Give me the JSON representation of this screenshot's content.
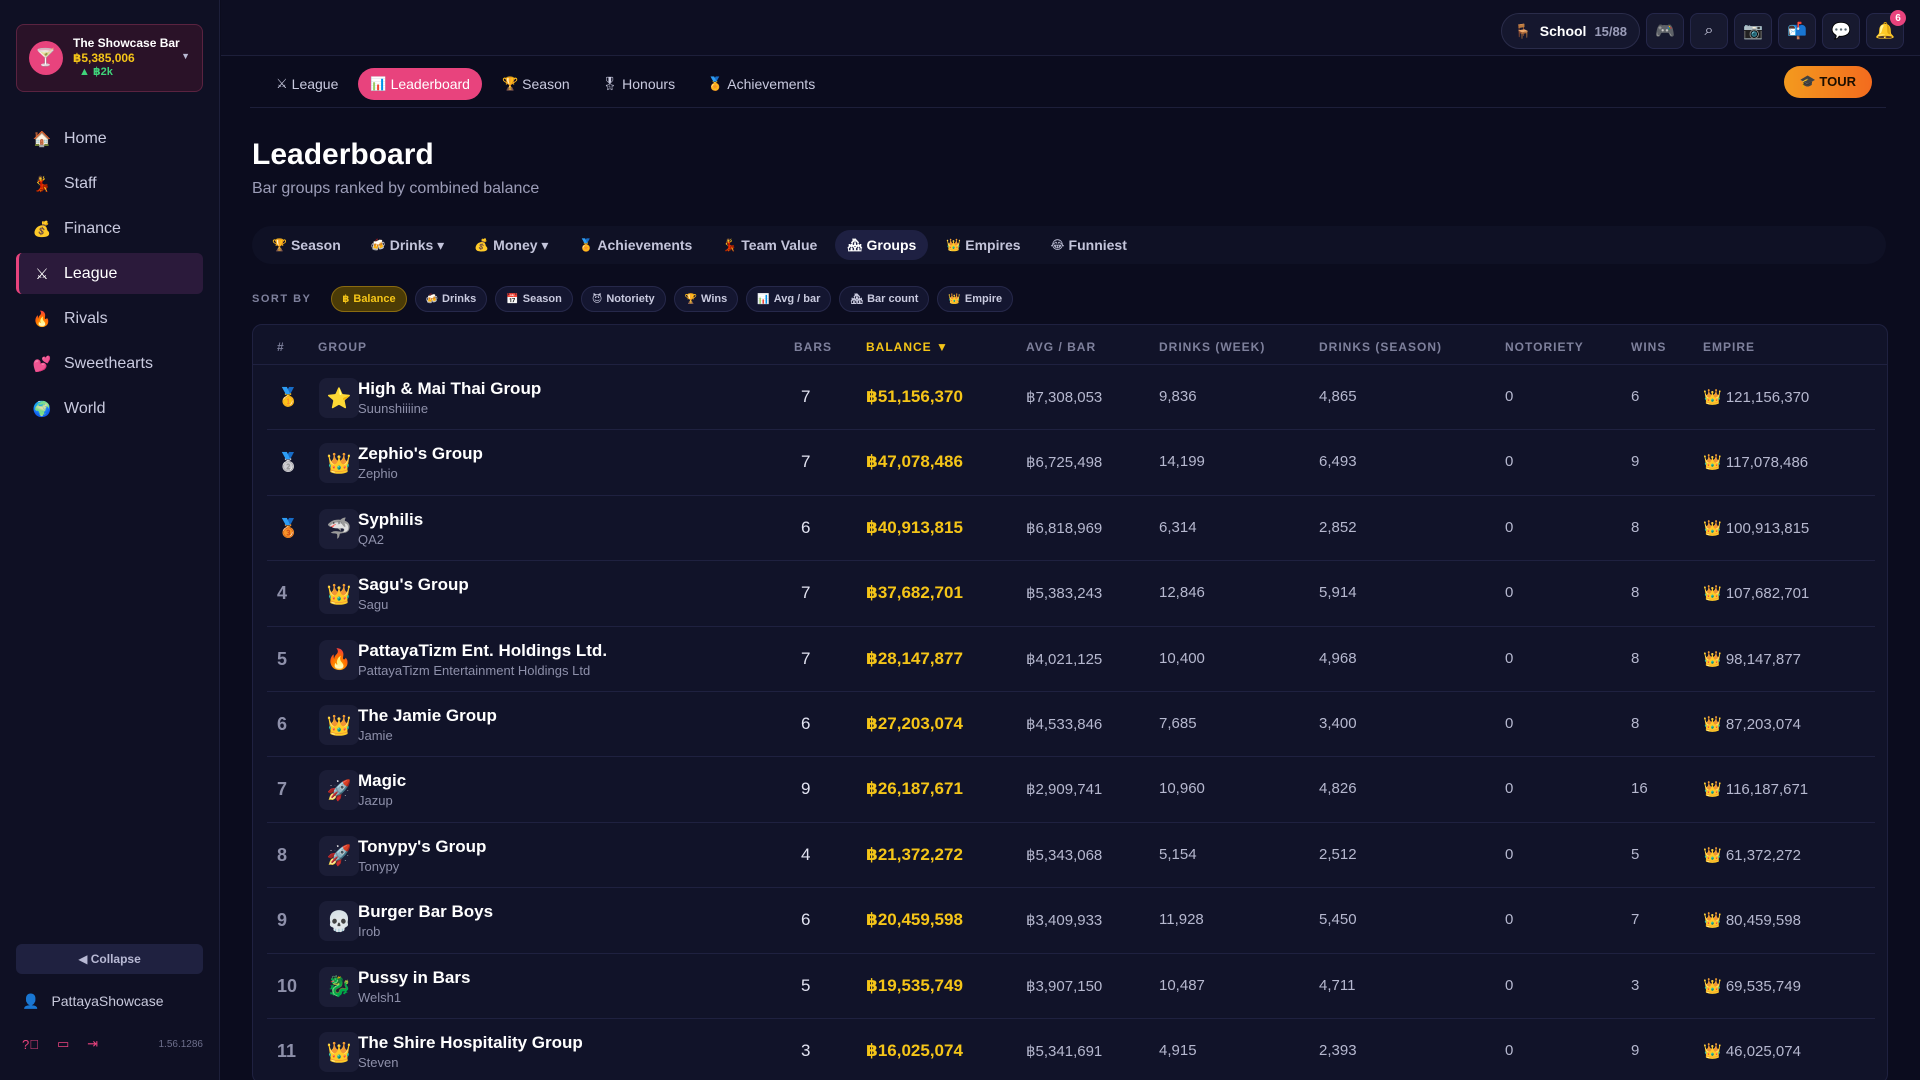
{
  "bar": {
    "name": "The Showcase Bar",
    "balance": "฿5,385,006",
    "delta": "▲ ฿2k",
    "logo": "🍸"
  },
  "nav": [
    {
      "icon": "🏠",
      "label": "Home",
      "icon_name": "home-icon"
    },
    {
      "icon": "💃",
      "label": "Staff",
      "icon_name": "staff-icon"
    },
    {
      "icon": "💰",
      "label": "Finance",
      "icon_name": "money-bag-icon"
    },
    {
      "icon": "⚔",
      "label": "League",
      "icon_name": "crossed-swords-icon",
      "active": true
    },
    {
      "icon": "🔥",
      "label": "Rivals",
      "icon_name": "fire-icon"
    },
    {
      "icon": "💕",
      "label": "Sweethearts",
      "icon_name": "hearts-icon"
    },
    {
      "icon": "🌍",
      "label": "World",
      "icon_name": "globe-icon"
    }
  ],
  "sidebar": {
    "collapse_label": "◀ Collapse",
    "username": "PattayaShowcase",
    "version": "1.56.1286"
  },
  "topbar": {
    "school_label": "School",
    "school_count": "15/88",
    "notifications": "6"
  },
  "tabs": [
    {
      "icon": "⚔",
      "label": "League"
    },
    {
      "icon": "📊",
      "label": "Leaderboard",
      "active": true
    },
    {
      "icon": "🏆",
      "label": "Season"
    },
    {
      "icon": "🎖",
      "label": "Honours"
    },
    {
      "icon": "🏅",
      "label": "Achievements"
    }
  ],
  "tour_label": "🎓 TOUR",
  "page": {
    "title": "Leaderboard",
    "subtitle": "Bar groups ranked by combined balance"
  },
  "categories": [
    {
      "icon": "🏆",
      "label": "Season"
    },
    {
      "icon": "🍻",
      "label": "Drinks ▾"
    },
    {
      "icon": "💰",
      "label": "Money ▾"
    },
    {
      "icon": "🏅",
      "label": "Achievements"
    },
    {
      "icon": "💃",
      "label": "Team Value"
    },
    {
      "icon": "🏘",
      "label": "Groups",
      "active": true
    },
    {
      "icon": "👑",
      "label": "Empires"
    },
    {
      "icon": "😂",
      "label": "Funniest"
    }
  ],
  "sort": {
    "label": "SORT BY",
    "options": [
      {
        "icon": "฿",
        "label": "Balance",
        "active": true
      },
      {
        "icon": "🍻",
        "label": "Drinks"
      },
      {
        "icon": "📅",
        "label": "Season"
      },
      {
        "icon": "😈",
        "label": "Notoriety"
      },
      {
        "icon": "🏆",
        "label": "Wins"
      },
      {
        "icon": "📊",
        "label": "Avg / bar"
      },
      {
        "icon": "🏘",
        "label": "Bar count"
      },
      {
        "icon": "👑",
        "label": "Empire"
      }
    ]
  },
  "table": {
    "headers": {
      "rank": "#",
      "group": "GROUP",
      "bars": "BARS",
      "balance": "BALANCE ▼",
      "avg": "AVG / BAR",
      "dw": "DRINKS (WEEK)",
      "ds": "DRINKS (SEASON)",
      "noto": "NOTORIETY",
      "wins": "WINS",
      "empire": "EMPIRE"
    },
    "rows": [
      {
        "rank": "🥇",
        "icon": "⭐",
        "name": "High & Mai Thai Group",
        "owner": "Suunshiiiine",
        "bars": "7",
        "balance": "฿51,156,370",
        "avg": "฿7,308,053",
        "dw": "9,836",
        "ds": "4,865",
        "noto": "0",
        "wins": "6",
        "empire": "👑 121,156,370"
      },
      {
        "rank": "🥈",
        "icon": "👑",
        "name": "Zephio's Group",
        "owner": "Zephio",
        "bars": "7",
        "balance": "฿47,078,486",
        "avg": "฿6,725,498",
        "dw": "14,199",
        "ds": "6,493",
        "noto": "0",
        "wins": "9",
        "empire": "👑 117,078,486"
      },
      {
        "rank": "🥉",
        "icon": "🦈",
        "name": "Syphilis",
        "owner": "QA2",
        "bars": "6",
        "balance": "฿40,913,815",
        "avg": "฿6,818,969",
        "dw": "6,314",
        "ds": "2,852",
        "noto": "0",
        "wins": "8",
        "empire": "👑 100,913,815"
      },
      {
        "rank": "4",
        "icon": "👑",
        "name": "Sagu's Group",
        "owner": "Sagu",
        "bars": "7",
        "balance": "฿37,682,701",
        "avg": "฿5,383,243",
        "dw": "12,846",
        "ds": "5,914",
        "noto": "0",
        "wins": "8",
        "empire": "👑 107,682,701"
      },
      {
        "rank": "5",
        "icon": "🔥",
        "name": "PattayaTizm Ent. Holdings Ltd.",
        "owner": "PattayaTizm Entertainment Holdings Ltd",
        "bars": "7",
        "balance": "฿28,147,877",
        "avg": "฿4,021,125",
        "dw": "10,400",
        "ds": "4,968",
        "noto": "0",
        "wins": "8",
        "empire": "👑 98,147,877"
      },
      {
        "rank": "6",
        "icon": "👑",
        "name": "The Jamie Group",
        "owner": "Jamie",
        "bars": "6",
        "balance": "฿27,203,074",
        "avg": "฿4,533,846",
        "dw": "7,685",
        "ds": "3,400",
        "noto": "0",
        "wins": "8",
        "empire": "👑 87,203,074"
      },
      {
        "rank": "7",
        "icon": "🚀",
        "name": "Magic",
        "owner": "Jazup",
        "bars": "9",
        "balance": "฿26,187,671",
        "avg": "฿2,909,741",
        "dw": "10,960",
        "ds": "4,826",
        "noto": "0",
        "wins": "16",
        "empire": "👑 116,187,671"
      },
      {
        "rank": "8",
        "icon": "🚀",
        "name": "Tonypy's Group",
        "owner": "Tonypy",
        "bars": "4",
        "balance": "฿21,372,272",
        "avg": "฿5,343,068",
        "dw": "5,154",
        "ds": "2,512",
        "noto": "0",
        "wins": "5",
        "empire": "👑 61,372,272"
      },
      {
        "rank": "9",
        "icon": "💀",
        "name": "Burger Bar Boys",
        "owner": "Irob",
        "bars": "6",
        "balance": "฿20,459,598",
        "avg": "฿3,409,933",
        "dw": "11,928",
        "ds": "5,450",
        "noto": "0",
        "wins": "7",
        "empire": "👑 80,459,598"
      },
      {
        "rank": "10",
        "icon": "🐉",
        "name": "Pussy in Bars",
        "owner": "Welsh1",
        "bars": "5",
        "balance": "฿19,535,749",
        "avg": "฿3,907,150",
        "dw": "10,487",
        "ds": "4,711",
        "noto": "0",
        "wins": "3",
        "empire": "👑 69,535,749"
      },
      {
        "rank": "11",
        "icon": "👑",
        "name": "The Shire Hospitality Group",
        "owner": "Steven",
        "bars": "3",
        "balance": "฿16,025,074",
        "avg": "฿5,341,691",
        "dw": "4,915",
        "ds": "2,393",
        "noto": "0",
        "wins": "9",
        "empire": "👑 46,025,074"
      }
    ]
  }
}
